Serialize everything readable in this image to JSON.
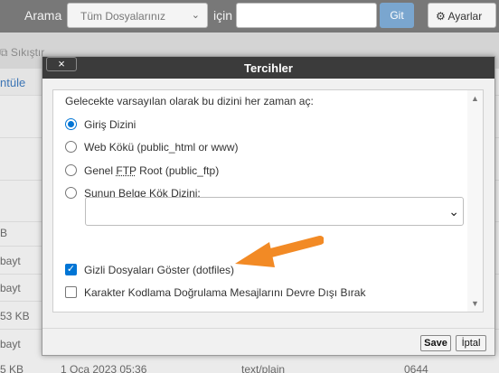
{
  "topbar": {
    "search_label": "Arama",
    "scope_select": "Tüm Dosyalarınız",
    "for_label": "için",
    "search_value": "",
    "go_button": "Git",
    "settings_button": "Ayarlar"
  },
  "toolbar": {
    "compress_label": "Sıkıştır"
  },
  "left_column": {
    "rows": [
      "ntüle",
      "",
      "",
      "",
      "B",
      "bayt",
      "bayt",
      "53 KB",
      "bayt"
    ]
  },
  "bottom_row": {
    "size": "5 KB",
    "date": "1 Oca 2023 05:36",
    "type": "text/plain",
    "perms": "0644"
  },
  "dialog": {
    "title": "Tercihler",
    "close_label": "×",
    "intro": "Gelecekte varsayılan olarak bu dizini her zaman aç:",
    "radio_options": [
      {
        "pre": "Giriş Dizini",
        "mid": "",
        "post": "",
        "selected": true
      },
      {
        "pre": "Web Kökü (public_html or www)",
        "mid": "",
        "post": "",
        "selected": false
      },
      {
        "pre": "Genel ",
        "mid": "FTP",
        "post": " Root (public_ftp)",
        "selected": false
      },
      {
        "pre": "Şunun Belge Kök Dizini:",
        "mid": "",
        "post": "",
        "selected": false
      }
    ],
    "docroot_select_value": "",
    "checkboxes": [
      {
        "label": "Gizli Dosyaları Göster (dotfiles)",
        "checked": true
      },
      {
        "label": "Karakter Kodlama Doğrulama Mesajlarını Devre Dışı Bırak",
        "checked": false
      }
    ],
    "save_button": "Save",
    "cancel_button": "İptal"
  },
  "colors": {
    "accent": "#0075d5",
    "annotation_arrow": "#f28a25",
    "title_bar": "#3b3b3b",
    "go_button": "#7aa6cf"
  }
}
